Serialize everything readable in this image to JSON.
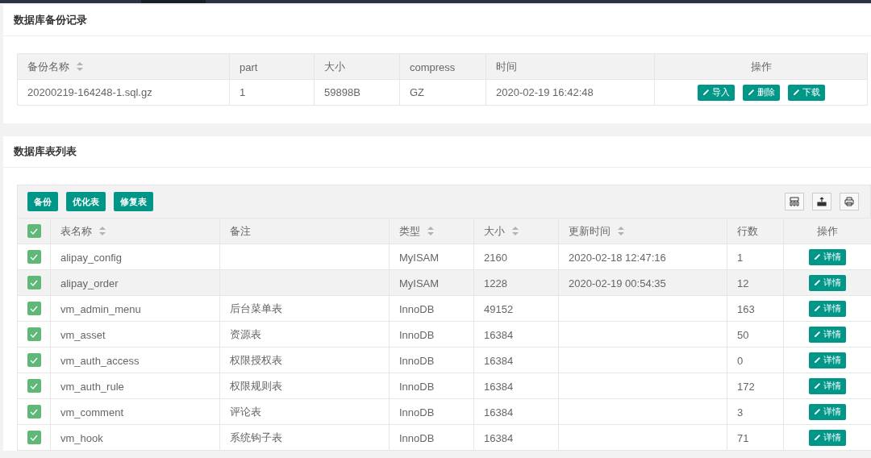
{
  "backup_panel": {
    "title": "数据库备份记录",
    "columns": [
      {
        "label": "备份名称",
        "sortable": true
      },
      {
        "label": "part",
        "sortable": false
      },
      {
        "label": "大小",
        "sortable": false
      },
      {
        "label": "compress",
        "sortable": false
      },
      {
        "label": "时间",
        "sortable": false
      },
      {
        "label": "操作",
        "sortable": false
      }
    ],
    "rows": [
      {
        "cells": [
          "20200219-164248-1.sql.gz",
          "1",
          "59898B",
          "GZ",
          "2020-02-19 16:42:48"
        ],
        "actions": [
          "导入",
          "删除",
          "下载"
        ]
      }
    ]
  },
  "tables_panel": {
    "title": "数据库表列表",
    "toolbar_buttons": [
      "备份",
      "优化表",
      "修复表"
    ],
    "all_checked": true,
    "columns": [
      {
        "label": "表名称",
        "sortable": true
      },
      {
        "label": "备注",
        "sortable": false
      },
      {
        "label": "类型",
        "sortable": true
      },
      {
        "label": "大小",
        "sortable": true
      },
      {
        "label": "更新时间",
        "sortable": true
      },
      {
        "label": "行数",
        "sortable": false
      },
      {
        "label": "操作",
        "sortable": false
      }
    ],
    "rows": [
      {
        "checked": true,
        "hovered": false,
        "cells": [
          "alipay_config",
          "",
          "MyISAM",
          "2160",
          "2020-02-18 12:47:16",
          "1"
        ],
        "action": "详情"
      },
      {
        "checked": true,
        "hovered": true,
        "cells": [
          "alipay_order",
          "",
          "MyISAM",
          "1228",
          "2020-02-19 00:54:35",
          "12"
        ],
        "action": "详情"
      },
      {
        "checked": true,
        "hovered": false,
        "cells": [
          "vm_admin_menu",
          "后台菜单表",
          "InnoDB",
          "49152",
          "",
          "163"
        ],
        "action": "详情"
      },
      {
        "checked": true,
        "hovered": false,
        "cells": [
          "vm_asset",
          "资源表",
          "InnoDB",
          "16384",
          "",
          "50"
        ],
        "action": "详情"
      },
      {
        "checked": true,
        "hovered": false,
        "cells": [
          "vm_auth_access",
          "权限授权表",
          "InnoDB",
          "16384",
          "",
          "0"
        ],
        "action": "详情"
      },
      {
        "checked": true,
        "hovered": false,
        "cells": [
          "vm_auth_rule",
          "权限规则表",
          "InnoDB",
          "16384",
          "",
          "172"
        ],
        "action": "详情"
      },
      {
        "checked": true,
        "hovered": false,
        "cells": [
          "vm_comment",
          "评论表",
          "InnoDB",
          "16384",
          "",
          "3"
        ],
        "action": "详情"
      },
      {
        "checked": true,
        "hovered": false,
        "cells": [
          "vm_hook",
          "系统钩子表",
          "InnoDB",
          "16384",
          "",
          "71"
        ],
        "action": "详情"
      }
    ]
  }
}
